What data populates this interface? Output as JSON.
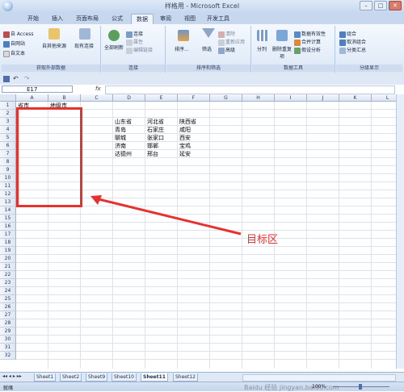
{
  "window": {
    "title": "样格用 - Microsoft Excel",
    "buttons": [
      "–",
      "□",
      "✕"
    ]
  },
  "ribbon_tabs": [
    "开始",
    "插入",
    "页面布局",
    "公式",
    "数据",
    "审阅",
    "视图",
    "开发工具"
  ],
  "ribbon_active_tab": "数据",
  "groups": {
    "external": {
      "label": "获取外部数据",
      "items": [
        "自 Access",
        "自网站",
        "自文本",
        "自其他来源",
        "现有连接"
      ]
    },
    "connections": {
      "label": "连接",
      "items": [
        "全部刷新",
        "连接",
        "属性",
        "编辑链接"
      ]
    },
    "sortfilter": {
      "label": "排序和筛选",
      "items": [
        "排序...",
        "筛选",
        "清除",
        "重新应用",
        "高级"
      ]
    },
    "datatools": {
      "label": "数据工具",
      "items": [
        "分列",
        "删除重复项",
        "数据有效性",
        "合并计算",
        "假设分析"
      ]
    },
    "outline": {
      "label": "分级显示",
      "items": [
        "组合",
        "取消组合",
        "分类汇总"
      ]
    }
  },
  "formula_bar": {
    "name_box": "E17",
    "fx": "fx",
    "value": ""
  },
  "columns": [
    "A",
    "B",
    "C",
    "D",
    "E",
    "F",
    "G",
    "H",
    "I",
    "J",
    "K",
    "L"
  ],
  "rows": [
    "1",
    "2",
    "3",
    "4",
    "5",
    "6",
    "7",
    "8",
    "9",
    "10",
    "11",
    "12",
    "13",
    "14",
    "15",
    "16",
    "17",
    "18",
    "19",
    "20",
    "21",
    "22",
    "23",
    "24",
    "25",
    "26",
    "27",
    "28",
    "29",
    "30",
    "31",
    "32"
  ],
  "cells": {
    "A1": "省市",
    "B1": "地级市",
    "D3": "山东省",
    "E3": "河北省",
    "F3": "陕西省",
    "D4": "青岛",
    "E4": "石家庄",
    "F4": "咸阳",
    "D5": "聊城",
    "E5": "张家口",
    "F5": "西安",
    "D6": "济南",
    "E6": "邯郸",
    "F6": "宝鸡",
    "D7": "达德州",
    "E7": "邢台",
    "F7": "延安"
  },
  "annotation": "目标区",
  "sheets": [
    "Sheet1",
    "Sheet2",
    "Sheet9",
    "Sheet10",
    "Sheet11",
    "Sheet12"
  ],
  "active_sheet": "Sheet11",
  "status": {
    "mode": "就绪",
    "zoom": "100%"
  },
  "watermark": "Baidu 经验 jingyan.baidu.com",
  "colors": {
    "accent_red": "#e6322f",
    "ribbon_blue": "#c7d7ee"
  }
}
